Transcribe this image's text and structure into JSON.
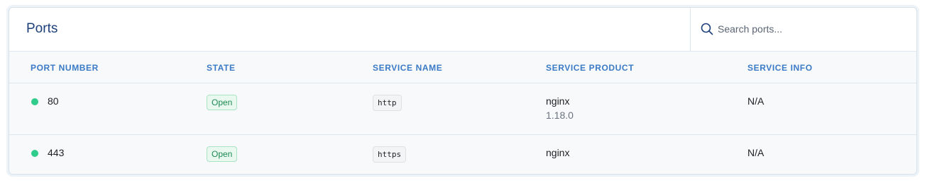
{
  "header": {
    "title": "Ports",
    "search_placeholder": "Search ports..."
  },
  "columns": [
    "PORT NUMBER",
    "STATE",
    "SERVICE NAME",
    "SERVICE PRODUCT",
    "SERVICE INFO"
  ],
  "rows": [
    {
      "port": "80",
      "state": "Open",
      "service_name": "http",
      "service_product": "nginx",
      "service_version": "1.18.0",
      "service_info": "N/A"
    },
    {
      "port": "443",
      "state": "Open",
      "service_name": "https",
      "service_product": "nginx",
      "service_info": "N/A"
    }
  ],
  "colors": {
    "status_dot": "#2fcc8b",
    "header_text": "#3a7ac6",
    "title": "#1d3f7a"
  }
}
